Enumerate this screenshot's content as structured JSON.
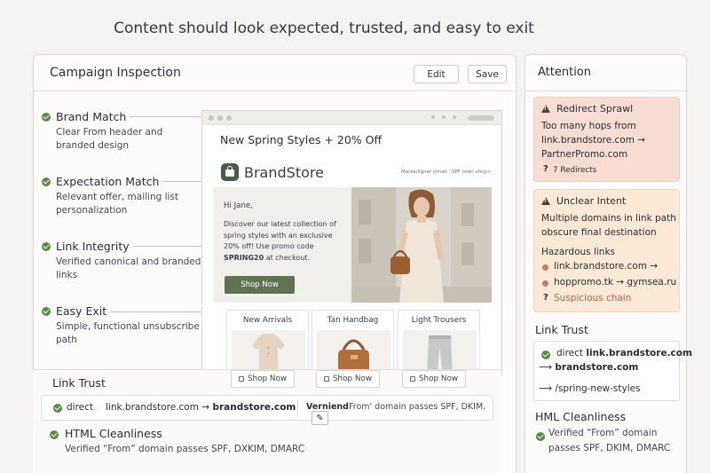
{
  "headline": "Content should look expected, trusted, and easy to exit",
  "inspection": {
    "title": "Campaign Inspection",
    "edit_label": "Edit",
    "save_label": "Save"
  },
  "features": [
    {
      "title": "Brand Match",
      "desc": "Clear From header and branded design"
    },
    {
      "title": "Expectation Match",
      "desc": "Relevant offer, mailing list personalization"
    },
    {
      "title": "Link Integrity",
      "desc": "Verified canonical and branded links"
    },
    {
      "title": "Easy Exit",
      "desc": "Simple, functional unsubscribe path"
    }
  ],
  "email": {
    "subject": "New Spring Styles + 20% Off",
    "brand": "BrandStore",
    "brand_meta": "Marke/ligner |rmail · SPF lookl vhcp>",
    "greeting": "Hi Jane,",
    "body_part1": "Discover our latest collection of spring styles with an exclusive 20% off! Use promo code ",
    "promo_code": "SPRING20",
    "body_part2": " at checkout.",
    "cta": "Shop Now",
    "products": [
      {
        "name": "New Arrivals",
        "cta": "Shop Now"
      },
      {
        "name": "Tan Handbag",
        "cta": "Shop Now"
      },
      {
        "name": "Light Trousers",
        "cta": "Shop Now"
      }
    ]
  },
  "link_trust_bottom": {
    "title": "Link Trust",
    "direct": "direct",
    "chain_from": "link.brandstore.com →",
    "chain_to": "brandstore.com",
    "verified": "Verniend",
    "pass_text": "From' domain passes SPF, DKIM,"
  },
  "html_cleanliness_bottom": {
    "title": "HTML Cleanliness",
    "desc": "Verified “From” domain passes SPF, DXKIM, DMARC"
  },
  "attention": {
    "title": "Attention",
    "redirect": {
      "title": "Redirect Sprawl",
      "line1": "Too many hops from",
      "line2": "link.brandstore.com →",
      "line3": "PartnerPromo.com",
      "count": "7 Redirects"
    },
    "intent": {
      "title": "Unclear Intent",
      "line1": "Multiple domains in link path",
      "line2": "obscure final destination",
      "hazard_label": "Hazardous links",
      "link1": "link.brandstore.com →",
      "link2": "hoppromo.tk → gymsea.ru",
      "suspicious": "Suspicious chain"
    }
  },
  "side_link_trust": {
    "title": "Link Trust",
    "direct": "direct",
    "l1": "link.brandstore.com",
    "l2": "brandstore.com",
    "l3": "/spring-new-styles",
    "arrow": "⟶"
  },
  "side_html": {
    "title": "HML Cleanliness",
    "desc": "Verified “From” domain passes SPF, DKIM, DMARC"
  },
  "colors": {
    "accent_green": "#5a8a44",
    "cta_green": "#5e7351",
    "danger_bg": "#f7ddd4",
    "warning_bg": "#fbe9d8",
    "suspicious_text": "#b5654b"
  }
}
